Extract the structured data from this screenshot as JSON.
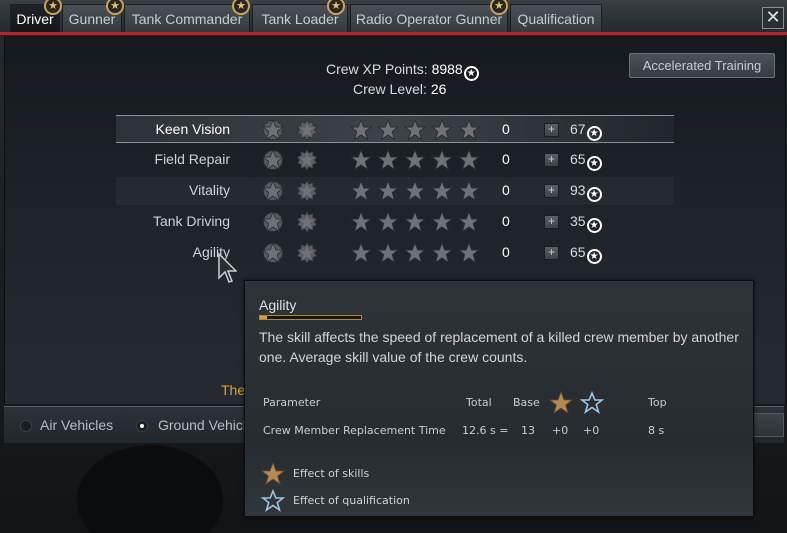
{
  "tabs": [
    {
      "label": "Driver",
      "active": true,
      "badge": false
    },
    {
      "label": "Gunner",
      "active": false,
      "badge": true
    },
    {
      "label": "Tank Commander",
      "active": false,
      "badge": true
    },
    {
      "label": "Tank Loader",
      "active": false,
      "badge": false
    },
    {
      "label": "Radio Operator Gunner",
      "active": false,
      "badge": true
    },
    {
      "label": "Qualification",
      "active": false,
      "badge": false
    }
  ],
  "close_label": "✕",
  "crew": {
    "xp_label": "Crew XP Points:",
    "xp_value": "8988",
    "level_label": "Crew Level:",
    "level_value": "26"
  },
  "accelerated_training_label": "Accelerated Training",
  "skills": [
    {
      "name": "Keen Vision",
      "value": "0",
      "stars_filled": 0,
      "stars_total": 5,
      "cost": "67"
    },
    {
      "name": "Field Repair",
      "value": "0",
      "stars_filled": 0,
      "stars_total": 5,
      "cost": "65"
    },
    {
      "name": "Vitality",
      "value": "0",
      "stars_filled": 0,
      "stars_total": 5,
      "cost": "93"
    },
    {
      "name": "Tank Driving",
      "value": "0",
      "stars_filled": 0,
      "stars_total": 5,
      "cost": "35"
    },
    {
      "name": "Agility",
      "value": "0",
      "stars_filled": 0,
      "stars_total": 5,
      "cost": "65"
    }
  ],
  "notice_text": "The",
  "vehicle_filter": [
    {
      "label": "Air Vehicles",
      "selected": false
    },
    {
      "label": "Ground Vehicles",
      "selected": true
    }
  ],
  "tooltip": {
    "title": "Agility",
    "progress": 0.07,
    "description": "The skill affects the speed of replacement of a killed crew member by another one. Average skill value of the crew counts.",
    "table": {
      "headers": [
        "Parameter",
        "Total",
        "Base",
        "skills-star",
        "qualification-star",
        "Top"
      ],
      "rows": [
        {
          "parameter": "Crew Member Replacement Time",
          "total": "12.6 s =",
          "base": "13",
          "skills": "+0",
          "qualification": "+0",
          "top": "8 s"
        }
      ]
    },
    "legend": [
      {
        "icon": "skills-star-icon",
        "label": "Effect of skills"
      },
      {
        "icon": "qualification-star-icon",
        "label": "Effect of qualification"
      }
    ]
  },
  "colors": {
    "accent_red": "#b3262a",
    "gold": "#c9a35a",
    "notice": "#d9a432",
    "qualification_blue": "#9fc3e0"
  }
}
